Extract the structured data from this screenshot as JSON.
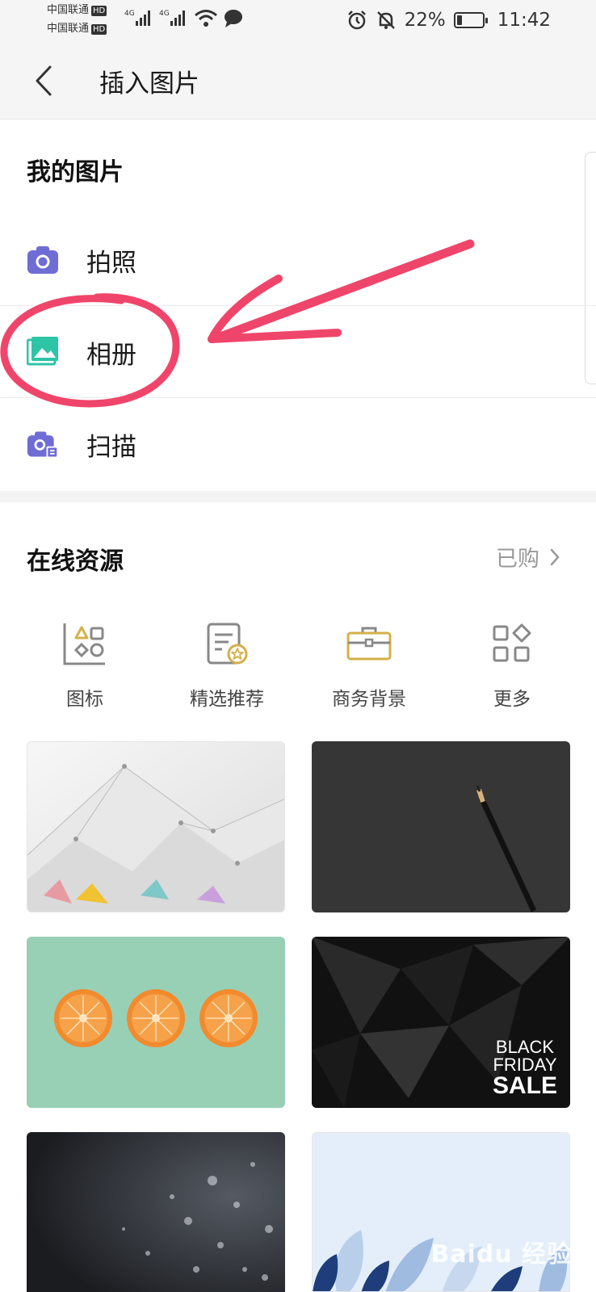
{
  "status_bar": {
    "carrier_1": "中国联通",
    "carrier_2": "中国联通",
    "hd_badge": "HD",
    "network": "4G",
    "battery": "22%",
    "battery_level": 0.22,
    "time": "11:42",
    "icons": [
      "signal-icon",
      "wifi-icon",
      "message-icon",
      "alarm-icon",
      "mute-bell-icon",
      "battery-icon"
    ]
  },
  "header": {
    "title": "插入图片",
    "back_icon": "chevron-left-icon"
  },
  "my_pictures": {
    "title": "我的图片",
    "items": [
      {
        "label": "拍照",
        "icon": "camera-icon",
        "color": "#6f6cd4"
      },
      {
        "label": "相册",
        "icon": "gallery-icon",
        "color": "#2ec4a6"
      },
      {
        "label": "扫描",
        "icon": "scan-icon",
        "color": "#6f6cd4"
      }
    ]
  },
  "online_resources": {
    "title": "在线资源",
    "purchased_link": "已购",
    "categories": [
      {
        "label": "图标",
        "icon": "shapes-icon"
      },
      {
        "label": "精选推荐",
        "icon": "featured-doc-icon"
      },
      {
        "label": "商务背景",
        "icon": "briefcase-icon"
      },
      {
        "label": "更多",
        "icon": "more-grid-icon"
      }
    ],
    "thumbnails": [
      {
        "name": "geometric-white-background"
      },
      {
        "name": "pencil-dark-background"
      },
      {
        "name": "orange-slices-background"
      },
      {
        "name": "black-polygon-background",
        "text_lines": [
          "BLACK",
          "FRIDAY",
          "SALE"
        ]
      },
      {
        "name": "bokeh-dark-background"
      },
      {
        "name": "leaves-light-background"
      }
    ]
  },
  "watermark": "Baidu 经验",
  "colors": {
    "accent": "#6f6cd4",
    "gallery_green": "#2ec4a6",
    "annotation_red": "#f0456a",
    "gold": "#d4b04a"
  }
}
